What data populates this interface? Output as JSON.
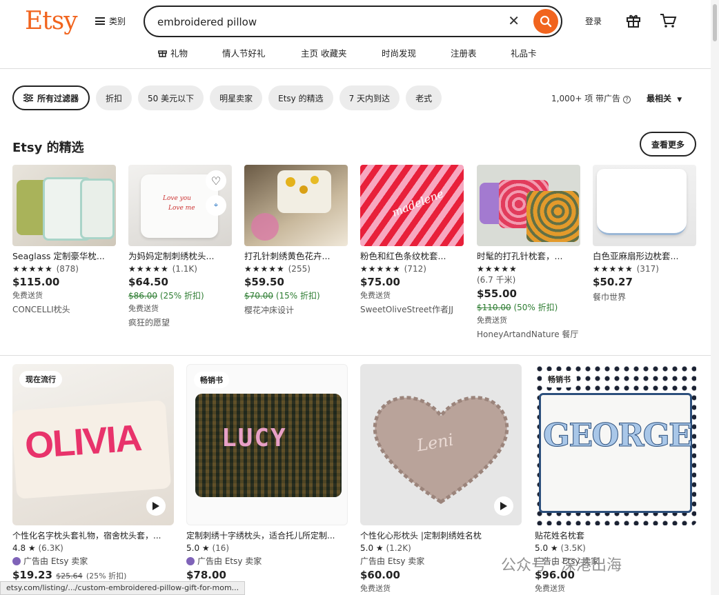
{
  "header": {
    "logo": "Etsy",
    "categories_label": "类别",
    "search_value": "embroidered pillow",
    "login_label": "登录",
    "nav": [
      "礼物",
      "情人节好礼",
      "主页 收藏夹",
      "时尚发现",
      "注册表",
      "礼品卡"
    ]
  },
  "filters": {
    "all_label": "所有过滤器",
    "chips": [
      "折扣",
      "50 美元以下",
      "明星卖家",
      "Etsy 的精选",
      "7 天内到达",
      "老式"
    ],
    "results_label": "1,000+ 项 带广告",
    "sort_label": "最相关"
  },
  "picks": {
    "title": "Etsy 的精选",
    "see_more": "查看更多",
    "items": [
      {
        "title": "Seaglass 定制豪华枕...",
        "rating": "★★★★★",
        "count": "(878)",
        "price": "$115.00",
        "orig": "",
        "discount": "",
        "ship": "免费送货",
        "shop": "CONCELLI枕头"
      },
      {
        "title": "为妈妈定制刺绣枕头...",
        "rating": "★★★★★",
        "count": "(1.1K)",
        "price": "$64.50",
        "orig": "$86.00",
        "discount": "(25% 折扣)",
        "ship": "免费送货",
        "shop": "疯狂的愿望"
      },
      {
        "title": "打孔针刺绣黄色花卉...",
        "rating": "★★★★★",
        "count": "(255)",
        "price": "$59.50",
        "orig": "$70.00",
        "discount": "(15% 折扣)",
        "ship": "",
        "shop": "樱花冲床设计"
      },
      {
        "title": "粉色和红色条纹枕套...",
        "rating": "★★★★★",
        "count": "(712)",
        "price": "$75.00",
        "orig": "",
        "discount": "",
        "ship": "免费送货",
        "shop": "SweetOliveStreet作者JJ"
      },
      {
        "title": "时髦的打孔针枕套，...",
        "rating": "★★★★★",
        "count": "(6.7 千米)",
        "price": "$55.00",
        "orig": "$110.00",
        "discount": "(50% 折扣)",
        "ship": "免费送货",
        "shop": "HoneyArtandNature 餐厅"
      },
      {
        "title": "白色亚麻扇形边枕套...",
        "rating": "★★★★★",
        "count": "(317)",
        "price": "$50.27",
        "orig": "",
        "discount": "",
        "ship": "",
        "shop": "餐巾世界"
      }
    ]
  },
  "grid": [
    {
      "badge": "现在流行",
      "image_text": "OLIVIA",
      "title": "个性化名字枕头套礼物，宿舍枕头套，...",
      "rating": "4.8 ★",
      "count": "(6.3K)",
      "ad": "广告由 Etsy 卖家",
      "price": "$19.23",
      "orig": "$25.64",
      "discount": "(25% 折扣)",
      "ship": ""
    },
    {
      "badge": "畅销书",
      "image_text": "LUCY",
      "title": "定制刺绣十字绣枕头，适合托儿所定制...",
      "rating": "5.0 ★",
      "count": "(16)",
      "ad": "广告由 Etsy 卖家",
      "price": "$78.00",
      "orig": "",
      "discount": "",
      "ship": ""
    },
    {
      "badge": "",
      "image_text": "Leni",
      "title": "个性化心形枕头 |定制刺绣姓名枕",
      "rating": "5.0 ★",
      "count": "(1.2K)",
      "ad": "广告由 Etsy 卖家",
      "price": "$60.00",
      "orig": "",
      "discount": "",
      "ship": "免费送货"
    },
    {
      "badge": "畅销书",
      "image_text": "GEORGE",
      "title": "贴花姓名枕套",
      "rating": "5.0 ★",
      "count": "(3.5K)",
      "ad": "广告由 Etsy 卖家",
      "price": "$96.00",
      "orig": "",
      "discount": "",
      "ship": "免费送货"
    }
  ],
  "status_url": "etsy.com/listing/.../custom-embroidered-pillow-gift-for-mom...",
  "watermark": "公众号 · 深港出海",
  "colors": {
    "accent": "#f1641e",
    "discount": "#2e7d32",
    "star_seller": "#7f63b8"
  }
}
